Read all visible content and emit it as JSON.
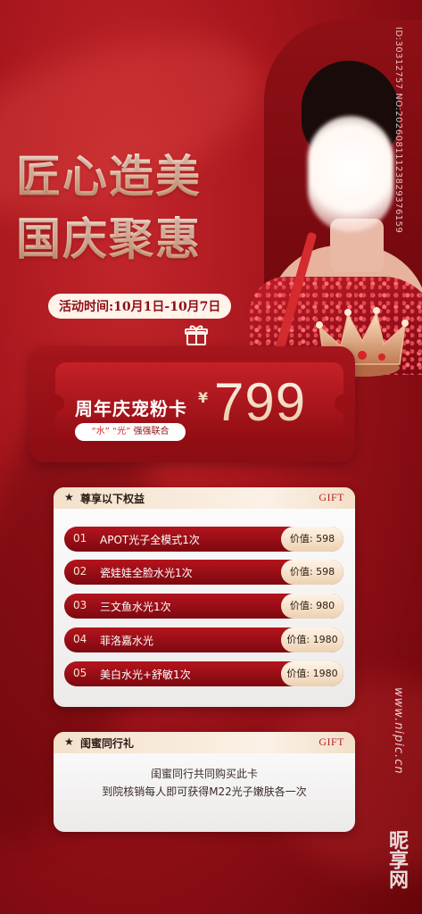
{
  "title": {
    "line1": "匠心造美",
    "line2": "国庆聚惠"
  },
  "date_pill": "活动时间:10月1日-10月7日",
  "card": {
    "name": "周年庆宠粉卡",
    "tagline_q1": "“水”",
    "tagline_q2": "“光”",
    "tagline_rest": "强强联合",
    "currency": "¥",
    "price": "799"
  },
  "benefits": {
    "header": "尊享以下权益",
    "gift": "GIFT",
    "items": [
      {
        "no": "01",
        "name": "APOT光子全模式1次",
        "value": "价值: 598"
      },
      {
        "no": "02",
        "name": "瓷娃娃全脸水光1次",
        "value": "价值: 598"
      },
      {
        "no": "03",
        "name": "三文鱼水光1次",
        "value": "价值: 980"
      },
      {
        "no": "04",
        "name": "菲洛嘉水光",
        "value": "价值: 1980"
      },
      {
        "no": "05",
        "name": "美白水光+舒敏1次",
        "value": "价值: 1980"
      }
    ]
  },
  "friends": {
    "header": "闺蜜同行礼",
    "gift": "GIFT",
    "line1": "闺蜜同行共同购买此卡",
    "line2": "到院核销每人即可获得M22光子嫩肤各一次"
  },
  "watermark": {
    "id": "ID:30312757 NO:20260811123829376159",
    "site": "www.nipic.cn",
    "logo": "昵享网"
  },
  "colors": {
    "brand_red": "#a5151c",
    "gold": "#e7c29c"
  }
}
